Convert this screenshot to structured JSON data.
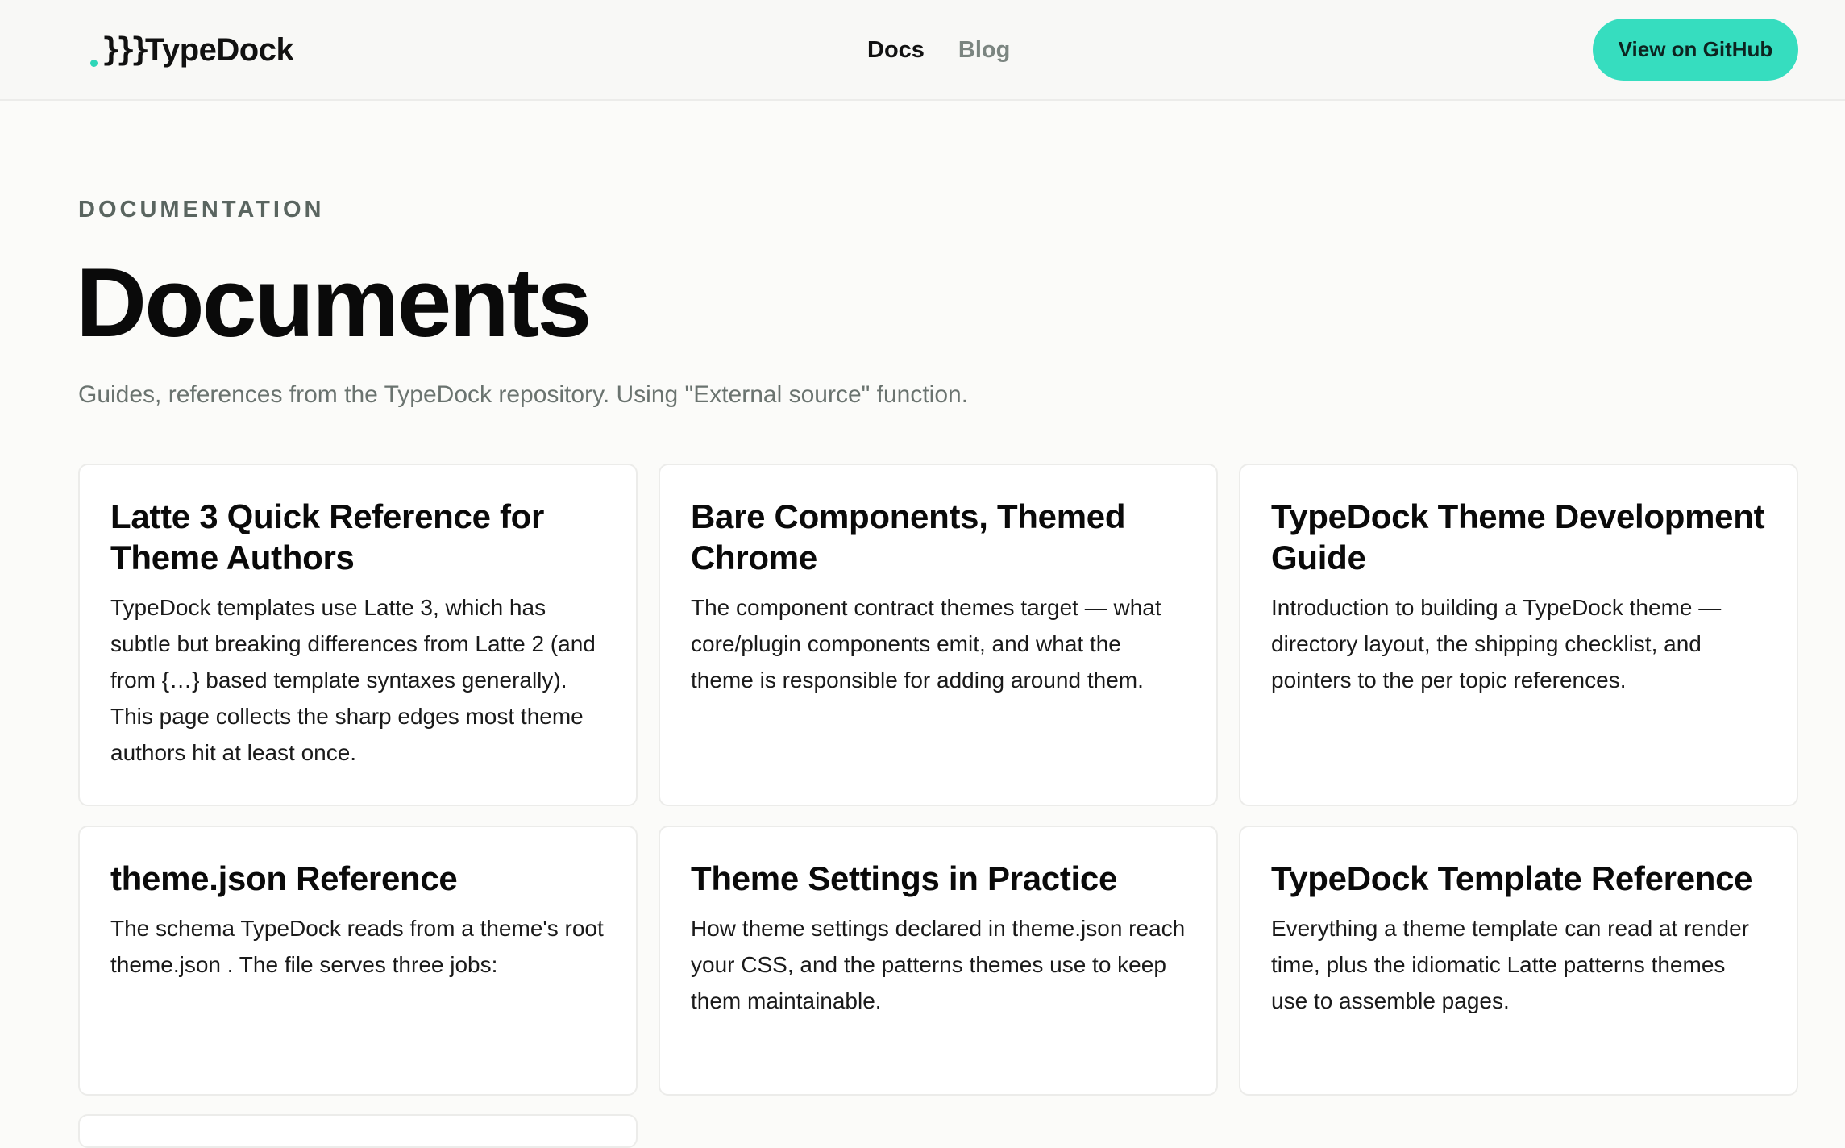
{
  "header": {
    "logo_text": "TypeDock",
    "logo_mark": "}}}",
    "nav": [
      {
        "label": "Docs",
        "active": true
      },
      {
        "label": "Blog",
        "active": false
      }
    ],
    "github_button": "View on GitHub"
  },
  "colors": {
    "accent": "#36ddbf",
    "muted": "#7b8580",
    "text": "#0a0a0a"
  },
  "page": {
    "eyebrow": "DOCUMENTATION",
    "title": "Documents",
    "subtitle": "Guides, references from the TypeDock repository. Using \"External source\" function."
  },
  "cards": [
    {
      "title": "Latte 3 Quick Reference for Theme Authors",
      "description": "TypeDock templates use Latte 3, which has subtle but breaking differences from Latte 2 (and from {…} based template syntaxes generally). This page collects the sharp edges most theme authors hit at least once."
    },
    {
      "title": "Bare Components, Themed Chrome",
      "description": "The component contract themes target — what core/plugin components emit, and what the theme is responsible for adding around them."
    },
    {
      "title": "TypeDock Theme Development Guide",
      "description": "Introduction to building a TypeDock theme — directory layout, the shipping checklist, and pointers to the per topic references."
    },
    {
      "title": "theme.json Reference",
      "description": "The schema TypeDock reads from a theme's root theme.json . The file serves three jobs:"
    },
    {
      "title": "Theme Settings in Practice",
      "description": "How theme settings declared in theme.json reach your CSS, and the patterns themes use to keep them maintainable."
    },
    {
      "title": "TypeDock Template Reference",
      "description": "Everything a theme template can read at render time, plus the idiomatic Latte patterns themes use to assemble pages."
    }
  ]
}
